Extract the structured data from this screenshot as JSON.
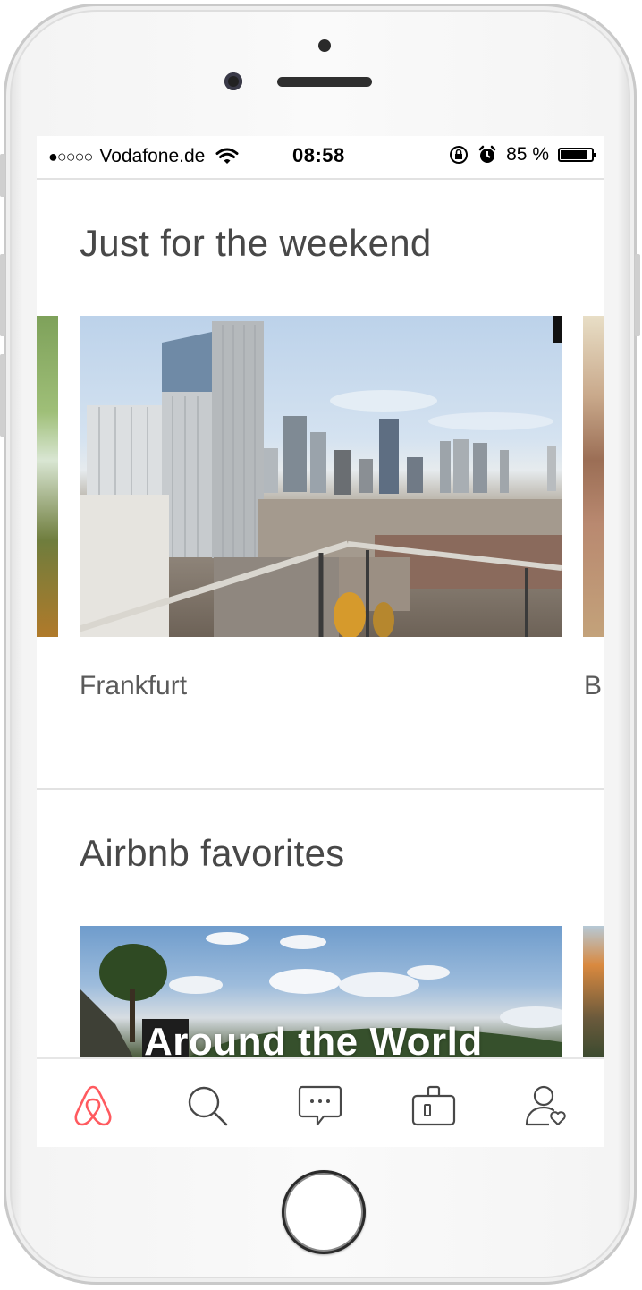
{
  "status_bar": {
    "signal_dots": "●○○○○",
    "carrier": "Vodafone.de",
    "time": "08:58",
    "battery_percent": "85 %",
    "battery_level": 0.85,
    "icons": [
      "wifi-icon",
      "rotation-lock-icon",
      "alarm-icon",
      "battery-icon"
    ]
  },
  "sections": {
    "weekend": {
      "title": "Just for the weekend",
      "cards": [
        {
          "label": "Frankfurt"
        },
        {
          "label": "Br"
        }
      ]
    },
    "favorites": {
      "title": "Airbnb favorites",
      "cards": [
        {
          "overlay_title": "Around the World"
        }
      ]
    }
  },
  "tab_bar": {
    "tabs": [
      {
        "icon": "airbnb-logo-icon",
        "active": true
      },
      {
        "icon": "search-icon",
        "active": false
      },
      {
        "icon": "messages-icon",
        "active": false
      },
      {
        "icon": "trips-icon",
        "active": false
      },
      {
        "icon": "profile-icon",
        "active": false
      }
    ],
    "active_color": "#ff5a5f",
    "inactive_color": "#484848"
  }
}
